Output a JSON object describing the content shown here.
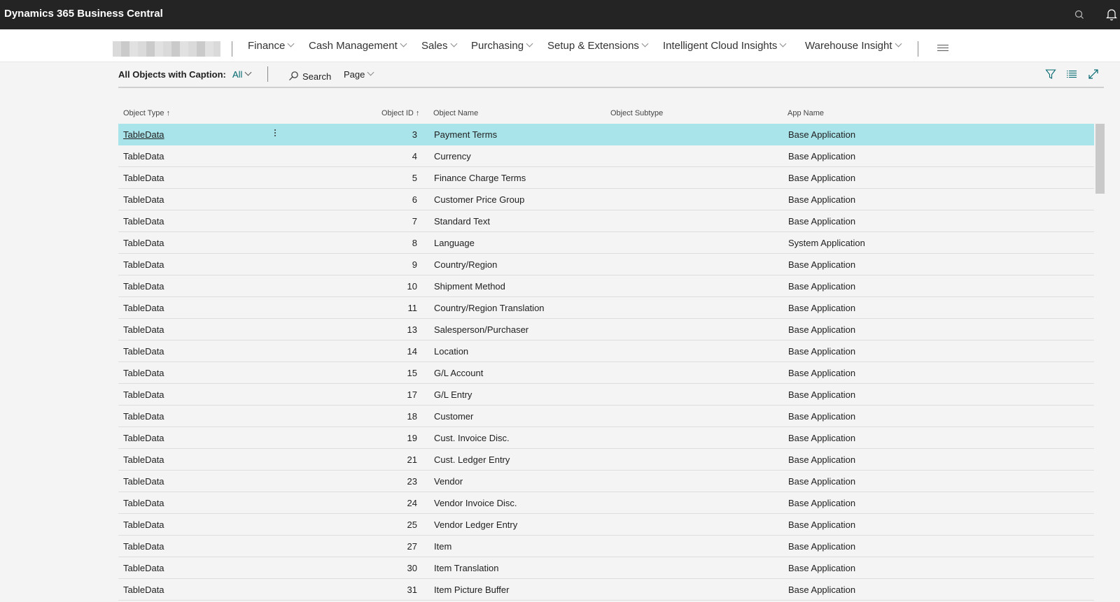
{
  "app": {
    "title": "Dynamics 365 Business Central"
  },
  "nav": {
    "items": [
      {
        "label": "Finance"
      },
      {
        "label": "Cash Management"
      },
      {
        "label": "Sales"
      },
      {
        "label": "Purchasing"
      },
      {
        "label": "Setup & Extensions"
      },
      {
        "label": "Intelligent Cloud Insights"
      },
      {
        "label": "Warehouse Insight"
      }
    ]
  },
  "actionbar": {
    "caption": "All Objects with Caption:",
    "filter_label": "All",
    "search_label": "Search",
    "page_label": "Page"
  },
  "table": {
    "columns": {
      "type": "Object Type",
      "id": "Object ID",
      "name": "Object Name",
      "subtype": "Object Subtype",
      "app": "App Name"
    },
    "sort_indicator": "↑",
    "rows": [
      {
        "type": "TableData",
        "id": "3",
        "name": "Payment Terms",
        "subtype": "",
        "app": "Base Application"
      },
      {
        "type": "TableData",
        "id": "4",
        "name": "Currency",
        "subtype": "",
        "app": "Base Application"
      },
      {
        "type": "TableData",
        "id": "5",
        "name": "Finance Charge Terms",
        "subtype": "",
        "app": "Base Application"
      },
      {
        "type": "TableData",
        "id": "6",
        "name": "Customer Price Group",
        "subtype": "",
        "app": "Base Application"
      },
      {
        "type": "TableData",
        "id": "7",
        "name": "Standard Text",
        "subtype": "",
        "app": "Base Application"
      },
      {
        "type": "TableData",
        "id": "8",
        "name": "Language",
        "subtype": "",
        "app": "System Application"
      },
      {
        "type": "TableData",
        "id": "9",
        "name": "Country/Region",
        "subtype": "",
        "app": "Base Application"
      },
      {
        "type": "TableData",
        "id": "10",
        "name": "Shipment Method",
        "subtype": "",
        "app": "Base Application"
      },
      {
        "type": "TableData",
        "id": "11",
        "name": "Country/Region Translation",
        "subtype": "",
        "app": "Base Application"
      },
      {
        "type": "TableData",
        "id": "13",
        "name": "Salesperson/Purchaser",
        "subtype": "",
        "app": "Base Application"
      },
      {
        "type": "TableData",
        "id": "14",
        "name": "Location",
        "subtype": "",
        "app": "Base Application"
      },
      {
        "type": "TableData",
        "id": "15",
        "name": "G/L Account",
        "subtype": "",
        "app": "Base Application"
      },
      {
        "type": "TableData",
        "id": "17",
        "name": "G/L Entry",
        "subtype": "",
        "app": "Base Application"
      },
      {
        "type": "TableData",
        "id": "18",
        "name": "Customer",
        "subtype": "",
        "app": "Base Application"
      },
      {
        "type": "TableData",
        "id": "19",
        "name": "Cust. Invoice Disc.",
        "subtype": "",
        "app": "Base Application"
      },
      {
        "type": "TableData",
        "id": "21",
        "name": "Cust. Ledger Entry",
        "subtype": "",
        "app": "Base Application"
      },
      {
        "type": "TableData",
        "id": "23",
        "name": "Vendor",
        "subtype": "",
        "app": "Base Application"
      },
      {
        "type": "TableData",
        "id": "24",
        "name": "Vendor Invoice Disc.",
        "subtype": "",
        "app": "Base Application"
      },
      {
        "type": "TableData",
        "id": "25",
        "name": "Vendor Ledger Entry",
        "subtype": "",
        "app": "Base Application"
      },
      {
        "type": "TableData",
        "id": "27",
        "name": "Item",
        "subtype": "",
        "app": "Base Application"
      },
      {
        "type": "TableData",
        "id": "30",
        "name": "Item Translation",
        "subtype": "",
        "app": "Base Application"
      },
      {
        "type": "TableData",
        "id": "31",
        "name": "Item Picture Buffer",
        "subtype": "",
        "app": "Base Application"
      }
    ],
    "selected_row": 0
  },
  "colors": {
    "appbar": "#242424",
    "selected_row": "#a9e4ea",
    "accent": "#00676e"
  },
  "icons": [
    "search-icon",
    "bell-icon",
    "hamburger-icon",
    "filter-icon",
    "list-view-icon",
    "expand-icon",
    "more-options-icon"
  ]
}
